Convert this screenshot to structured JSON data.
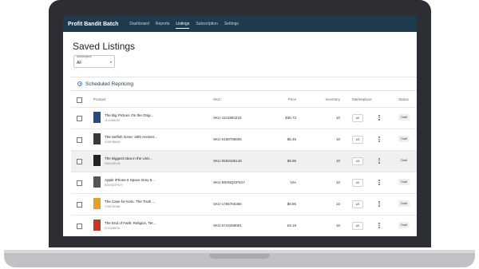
{
  "app": {
    "brand": "Profit Bandit Batch"
  },
  "nav": [
    {
      "label": "Dashboard",
      "active": false
    },
    {
      "label": "Reports",
      "active": false
    },
    {
      "label": "Listings",
      "active": true
    },
    {
      "label": "Subscription",
      "active": false
    },
    {
      "label": "Settings",
      "active": false
    }
  ],
  "page": {
    "title": "Saved Listings"
  },
  "filter": {
    "label": "Marketplace",
    "value": "All",
    "caret": "▾"
  },
  "scheduled": {
    "label": "Scheduled Repricing"
  },
  "table": {
    "columns": {
      "product": "Product",
      "sku": "SKU",
      "price": "Price",
      "inventory": "Inventory",
      "marketplace": "Marketplace",
      "status": "Status"
    },
    "rows": [
      {
        "title": "The Big Picture: On the Origi...",
        "sub": "1101984232",
        "sku": "SKU-1101984232",
        "price": "$36.73",
        "inventory": "10",
        "marketplace": "UK",
        "status": "Draft",
        "highlight": false,
        "thumb_color": "#2b4a7a"
      },
      {
        "title": "The Selfish Gene: 40th Anniver...",
        "sub": "0198788606",
        "sku": "SKU-0198788606",
        "price": "$6.45",
        "inventory": "10",
        "marketplace": "US",
        "status": "Draft",
        "highlight": false,
        "thumb_color": "#3a3a3a"
      },
      {
        "title": "The Biggest Idea in the Univ...",
        "sub": "0593186148",
        "sku": "SKU-0593186148",
        "price": "$9.96",
        "inventory": "10",
        "marketplace": "US",
        "status": "Draft",
        "highlight": true,
        "thumb_color": "#222222"
      },
      {
        "title": "Apple iPhone 6 Space Grey 6...",
        "sub": "B00NQGP42Y",
        "sku": "SKU-B00NQGP42Y",
        "price": "N/A",
        "inventory": "10",
        "marketplace": "UK",
        "status": "Draft",
        "highlight": false,
        "thumb_color": "#555555"
      },
      {
        "title": "The Case for Keto: The Truth ...",
        "sub": "1785766366",
        "sku": "SKU-1785766366",
        "price": "$8.96",
        "inventory": "10",
        "marketplace": "US",
        "status": "Draft",
        "highlight": false,
        "thumb_color": "#e0a22a"
      },
      {
        "title": "The End of Faith: Religion, Ter...",
        "sub": "0743268091",
        "sku": "SKU-0743268091",
        "price": "£9.19",
        "inventory": "10",
        "marketplace": "UK",
        "status": "Draft",
        "highlight": false,
        "thumb_color": "#c0392b"
      }
    ]
  }
}
